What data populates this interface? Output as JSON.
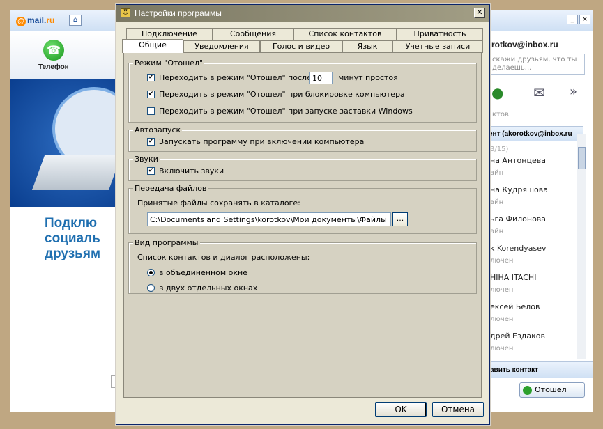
{
  "background_left": {
    "logo_prefix": "@",
    "logo_main": "mail.",
    "logo_suffix": "ru",
    "home_glyph": "⌂",
    "phone_label": "Телефон",
    "promo_lines": [
      "Подклю",
      "социаль",
      "друзьям"
    ]
  },
  "background_right": {
    "win_minimize": "_",
    "win_close": "×",
    "email": "rotkov@inbox.ru",
    "status_placeholder_1": "скажи друзьям, что ты",
    "status_placeholder_2": "делаешь...",
    "more_glyph": "»",
    "search_placeholder": "ктов",
    "group_header": "ент (akorotkov@inbox.ru",
    "group_count": "3/15)",
    "contacts": [
      {
        "name": "на Антонцева",
        "status": "айн"
      },
      {
        "name": "на Кудряшова",
        "status": "айн"
      },
      {
        "name": "ьга Филонова",
        "status": "айн"
      },
      {
        "name": "k Korendyasev",
        "status": "лючен"
      },
      {
        "name": "НІНА ITACHI",
        "status": "лючен"
      },
      {
        "name": "ексей Белов",
        "status": "лючен"
      },
      {
        "name": "дрей Ездаков",
        "status": "лючен"
      }
    ],
    "add_contact": "авить контакт",
    "away_button": "Отошел"
  },
  "dialog": {
    "title": "Настройки программы",
    "close_glyph": "✕",
    "tabs_row1": [
      "Подключение",
      "Сообщения",
      "Список контактов",
      "Приватность"
    ],
    "tabs_row2": [
      "Общие",
      "Уведомления",
      "Голос и видео",
      "Язык",
      "Учетные записи"
    ],
    "away_mode": {
      "title": "Режим \"Отошел\"",
      "idle_label": "Переходить в режим \"Отошел\" после",
      "idle_checked": true,
      "idle_minutes": "10",
      "idle_suffix": "минут простоя",
      "lock_label": "Переходить в режим \"Отошел\" при блокировке компьютера",
      "lock_checked": true,
      "screensaver_label": "Переходить в режим \"Отошел\" при запуске заставки Windows",
      "screensaver_checked": false
    },
    "autostart": {
      "title": "Автозапуск",
      "label": "Запускать программу при включении компьютера",
      "checked": true
    },
    "sounds": {
      "title": "Звуки",
      "label": "Включить звуки",
      "checked": true
    },
    "file_transfer": {
      "title": "Передача файлов",
      "label": "Принятые файлы сохранять в каталоге:",
      "path": "C:\\Documents and Settings\\korotkov\\Мои документы\\Файлы Mail.Ru А",
      "browse": "..."
    },
    "view": {
      "title": "Вид программы",
      "label": "Список контактов и диалог расположены:",
      "option_combined": "в объединенном окне",
      "option_separate": "в двух отдельных окнах",
      "selected": "combined"
    },
    "ok": "OK",
    "cancel": "Отмена"
  }
}
